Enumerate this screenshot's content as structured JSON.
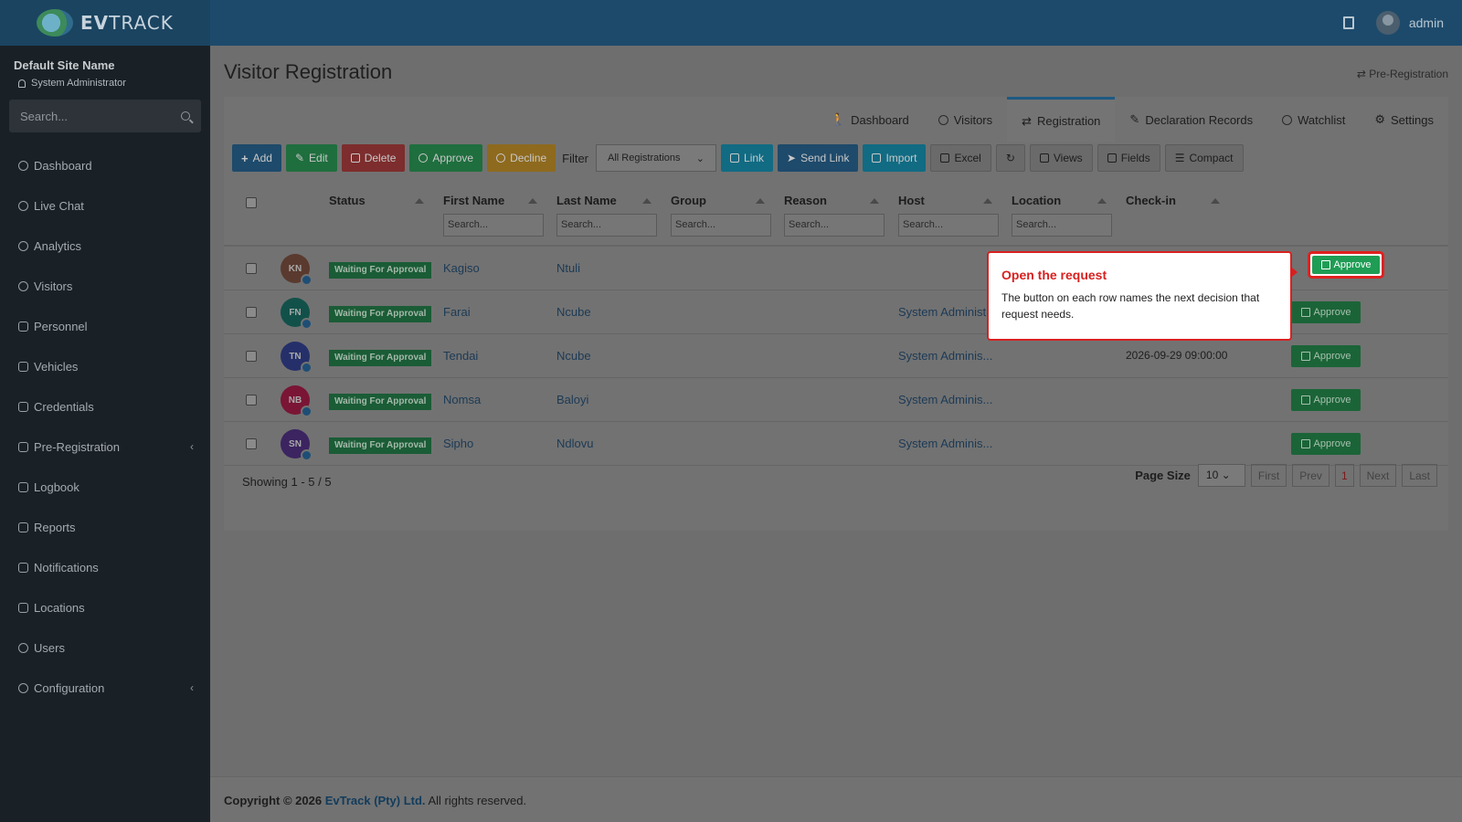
{
  "brand": {
    "name_bold": "EV",
    "name_rest": "TRACK"
  },
  "topbar": {
    "user": "admin"
  },
  "sidebar": {
    "site_name": "Default Site Name",
    "role": "System Administrator",
    "search_placeholder": "Search...",
    "items": [
      {
        "label": "Dashboard"
      },
      {
        "label": "Live Chat"
      },
      {
        "label": "Analytics"
      },
      {
        "label": "Visitors"
      },
      {
        "label": "Personnel"
      },
      {
        "label": "Vehicles"
      },
      {
        "label": "Credentials"
      },
      {
        "label": "Pre-Registration"
      },
      {
        "label": "Logbook"
      },
      {
        "label": "Reports"
      },
      {
        "label": "Notifications"
      },
      {
        "label": "Locations"
      },
      {
        "label": "Users"
      },
      {
        "label": "Configuration"
      }
    ]
  },
  "page": {
    "title": "Visitor Registration",
    "breadcrumb": "Pre-Registration"
  },
  "tabs": [
    {
      "label": "Dashboard"
    },
    {
      "label": "Visitors"
    },
    {
      "label": "Registration"
    },
    {
      "label": "Declaration Records"
    },
    {
      "label": "Watchlist"
    },
    {
      "label": "Settings"
    }
  ],
  "toolbar": {
    "add": "Add",
    "edit": "Edit",
    "delete": "Delete",
    "approve": "Approve",
    "decline": "Decline",
    "filter_label": "Filter",
    "filter_value": "All Registrations",
    "link": "Link",
    "send_link": "Send Link",
    "import": "Import",
    "excel": "Excel",
    "views": "Views",
    "fields": "Fields",
    "compact": "Compact"
  },
  "table": {
    "columns": [
      "Status",
      "First Name",
      "Last Name",
      "Group",
      "Reason",
      "Host",
      "Location",
      "Check-in"
    ],
    "search_placeholder": "Search...",
    "rows": [
      {
        "initials": "KN",
        "avatar_color": "#5a3a2e",
        "status": "Waiting For Approval",
        "first": "Kagiso",
        "last": "Ntuli",
        "host": "",
        "checkin": "",
        "action": "Approve"
      },
      {
        "initials": "FN",
        "avatar_color": "#12514a",
        "status": "Waiting For Approval",
        "first": "Farai",
        "last": "Ncube",
        "host": "System Administrator",
        "checkin": "",
        "action": "Approve"
      },
      {
        "initials": "TN",
        "avatar_color": "#25306a",
        "status": "Waiting For Approval",
        "first": "Tendai",
        "last": "Ncube",
        "host": "System Adminis...",
        "checkin": "2026-09-29 09:00:00",
        "action": "Approve"
      },
      {
        "initials": "NB",
        "avatar_color": "#7a1535",
        "status": "Waiting For Approval",
        "first": "Nomsa",
        "last": "Baloyi",
        "host": "System Adminis...",
        "checkin": "",
        "action": "Approve"
      },
      {
        "initials": "SN",
        "avatar_color": "#3b2460",
        "status": "Waiting For Approval",
        "first": "Sipho",
        "last": "Ndlovu",
        "host": "System Adminis...",
        "checkin": "",
        "action": "Approve"
      }
    ]
  },
  "pagination": {
    "showing": "Showing 1 - 5 / 5",
    "page_size_label": "Page Size",
    "page_size": "10",
    "first": "First",
    "prev": "Prev",
    "current": "1",
    "next": "Next",
    "last": "Last"
  },
  "footer": {
    "prefix": "Copyright © 2026",
    "company": "EvTrack (Pty) Ltd.",
    "suffix": "All rights reserved."
  },
  "tooltip": {
    "title": "Open the request",
    "body": "The button on each row names the next decision that request needs.",
    "button_label": "Approve"
  },
  "colors": {
    "highlight": "#e02020",
    "approve_green": "#1f9d55",
    "topbar": "#1d4a6b",
    "sidebar": "#1a2126"
  }
}
